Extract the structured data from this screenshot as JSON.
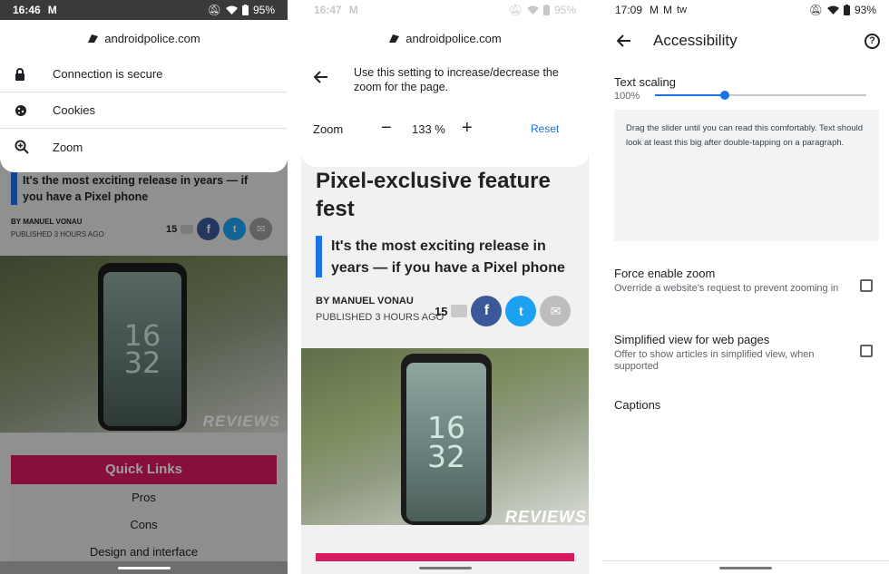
{
  "panel1": {
    "status": {
      "time": "16:46",
      "battery": "95%",
      "icons": [
        "gmail-icon",
        "mute-icon",
        "wifi-icon",
        "battery-icon"
      ]
    },
    "sheet": {
      "domain": "androidpolice.com",
      "items": [
        {
          "icon": "lock-icon",
          "label": "Connection is secure"
        },
        {
          "icon": "cookie-icon",
          "label": "Cookies"
        },
        {
          "icon": "zoom-icon",
          "label": "Zoom"
        }
      ]
    },
    "article": {
      "subtitle": "It's the most exciting release in years — if you have a Pixel phone",
      "byline": "BY MANUEL VONAU",
      "published": "PUBLISHED 3 HOURS AGO",
      "comment_count": "15",
      "clock": [
        "16",
        "32"
      ],
      "watermark": "REVIEWS"
    },
    "quick_links": {
      "heading": "Quick Links",
      "items": [
        "Pros",
        "Cons",
        "Design and interface"
      ]
    }
  },
  "panel2": {
    "status": {
      "time": "16:47",
      "battery": "95%"
    },
    "sheet": {
      "domain": "androidpolice.com",
      "description": "Use this setting to increase/decrease the zoom for the page.",
      "zoom_label": "Zoom",
      "zoom_value": "133 %",
      "minus": "−",
      "plus": "+",
      "reset": "Reset"
    },
    "article": {
      "title": "Pixel-exclusive feature fest",
      "subtitle": "It's the most exciting release in years — if you have a Pixel phone",
      "byline": "BY MANUEL VONAU",
      "published": "PUBLISHED 3 HOURS AGO",
      "comment_count": "15",
      "clock": [
        "16",
        "32"
      ],
      "watermark": "REVIEWS"
    }
  },
  "panel3": {
    "status": {
      "time": "17:09",
      "battery": "93%",
      "extra": "tw"
    },
    "title": "Accessibility",
    "text_scaling": {
      "label": "Text scaling",
      "value": "100%",
      "slider_fraction": 0.33,
      "preview": "Drag the slider until you can read this comfortably. Text should look at least this big after double-tapping on a paragraph."
    },
    "force_zoom": {
      "title": "Force enable zoom",
      "subtitle": "Override a website's request to prevent zooming in",
      "checked": false
    },
    "simplified": {
      "title": "Simplified view for web pages",
      "subtitle": "Offer to show articles in simplified view, when supported",
      "checked": false
    },
    "captions": "Captions"
  },
  "colors": {
    "accent_blue": "#1a73e8",
    "quick_links_pink": "#d81b60",
    "facebook": "#3b5998",
    "twitter": "#1da1f2",
    "email": "#9e9e9e"
  }
}
